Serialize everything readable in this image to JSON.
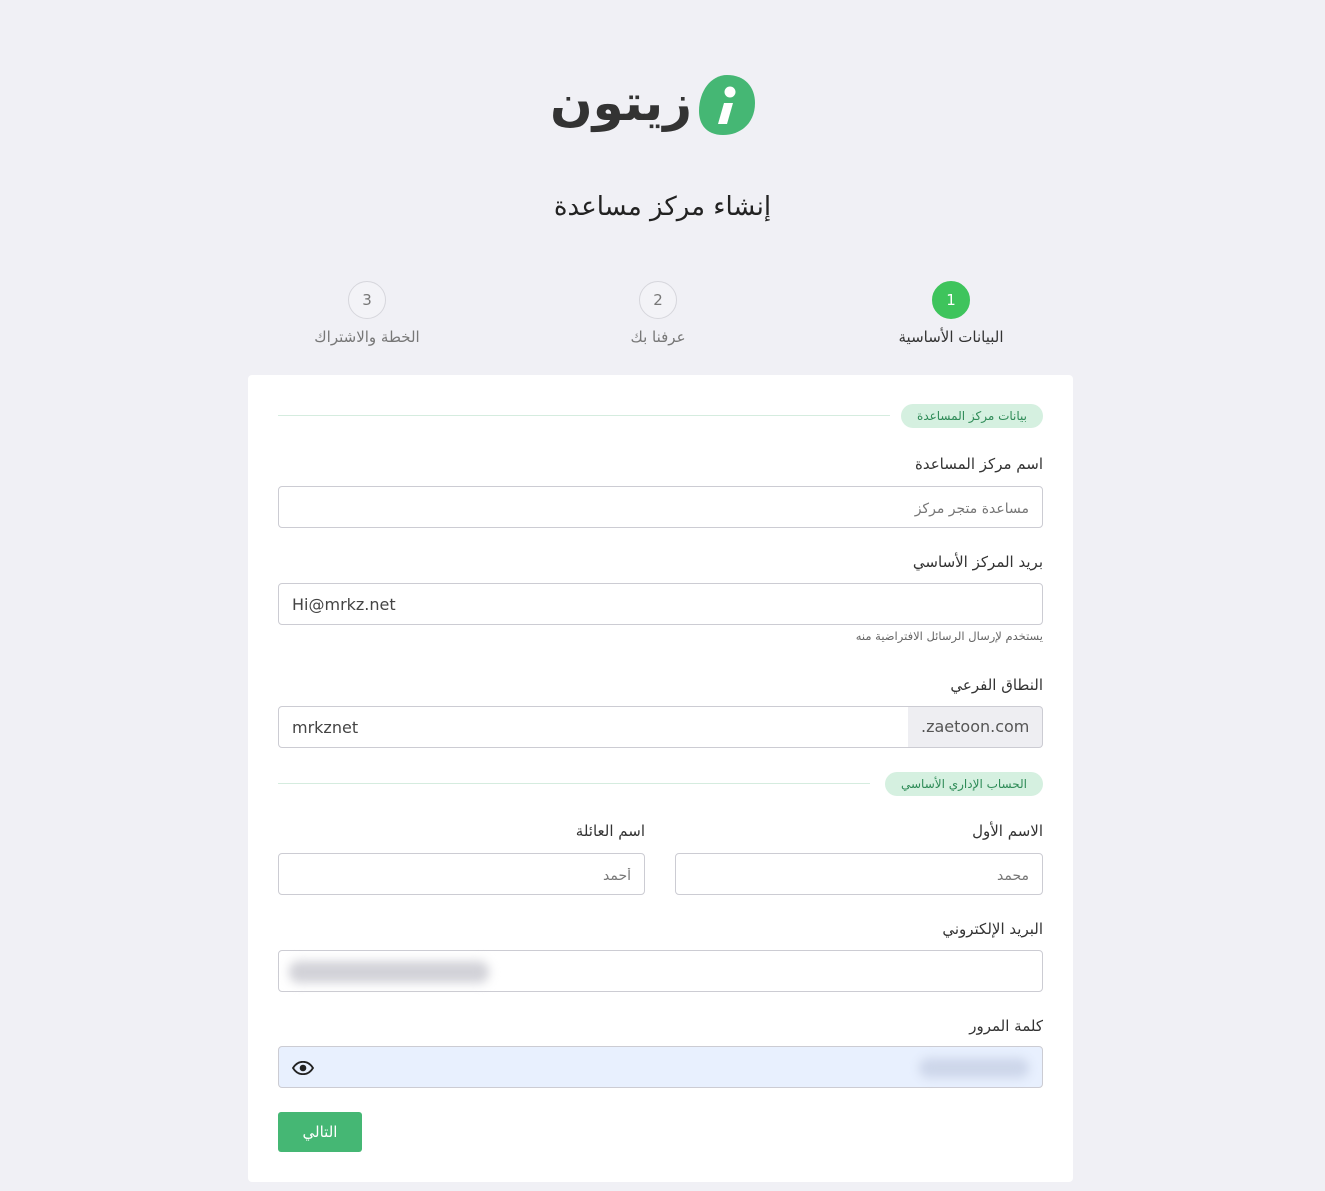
{
  "brand": {
    "name": "زيتون",
    "accent": "#45b774"
  },
  "page": {
    "title": "إنشاء مركز مساعدة"
  },
  "steps": [
    {
      "number": "1",
      "label": "البيانات الأساسية",
      "state": "active"
    },
    {
      "number": "2",
      "label": "عرفنا بك",
      "state": "pending"
    },
    {
      "number": "3",
      "label": "الخطة والاشتراك",
      "state": "pending"
    }
  ],
  "helpdesk_section": {
    "badge": "بيانات مركز المساعدة",
    "name": {
      "label": "اسم مركز المساعدة",
      "placeholder": "مساعدة متجر مركز",
      "value": ""
    },
    "email": {
      "label": "بريد المركز الأساسي",
      "value": "Hi@mrkz.net",
      "hint": "يستخدم لإرسال الرسائل الافتراضية منه"
    },
    "subdomain": {
      "label": "النطاق الفرعي",
      "value": "mrkznet",
      "suffix": ".zaetoon.com"
    }
  },
  "admin_section": {
    "badge": "الحساب الإداري الأساسي",
    "first_name": {
      "label": "الاسم الأول",
      "placeholder": "محمد",
      "value": ""
    },
    "last_name": {
      "label": "اسم العائلة",
      "placeholder": "أحمد",
      "value": ""
    },
    "email": {
      "label": "البريد الإلكتروني",
      "value": ""
    },
    "password": {
      "label": "كلمة المرور",
      "value": "",
      "toggle_icon": "eye-icon"
    }
  },
  "actions": {
    "next_label": "التالي"
  }
}
